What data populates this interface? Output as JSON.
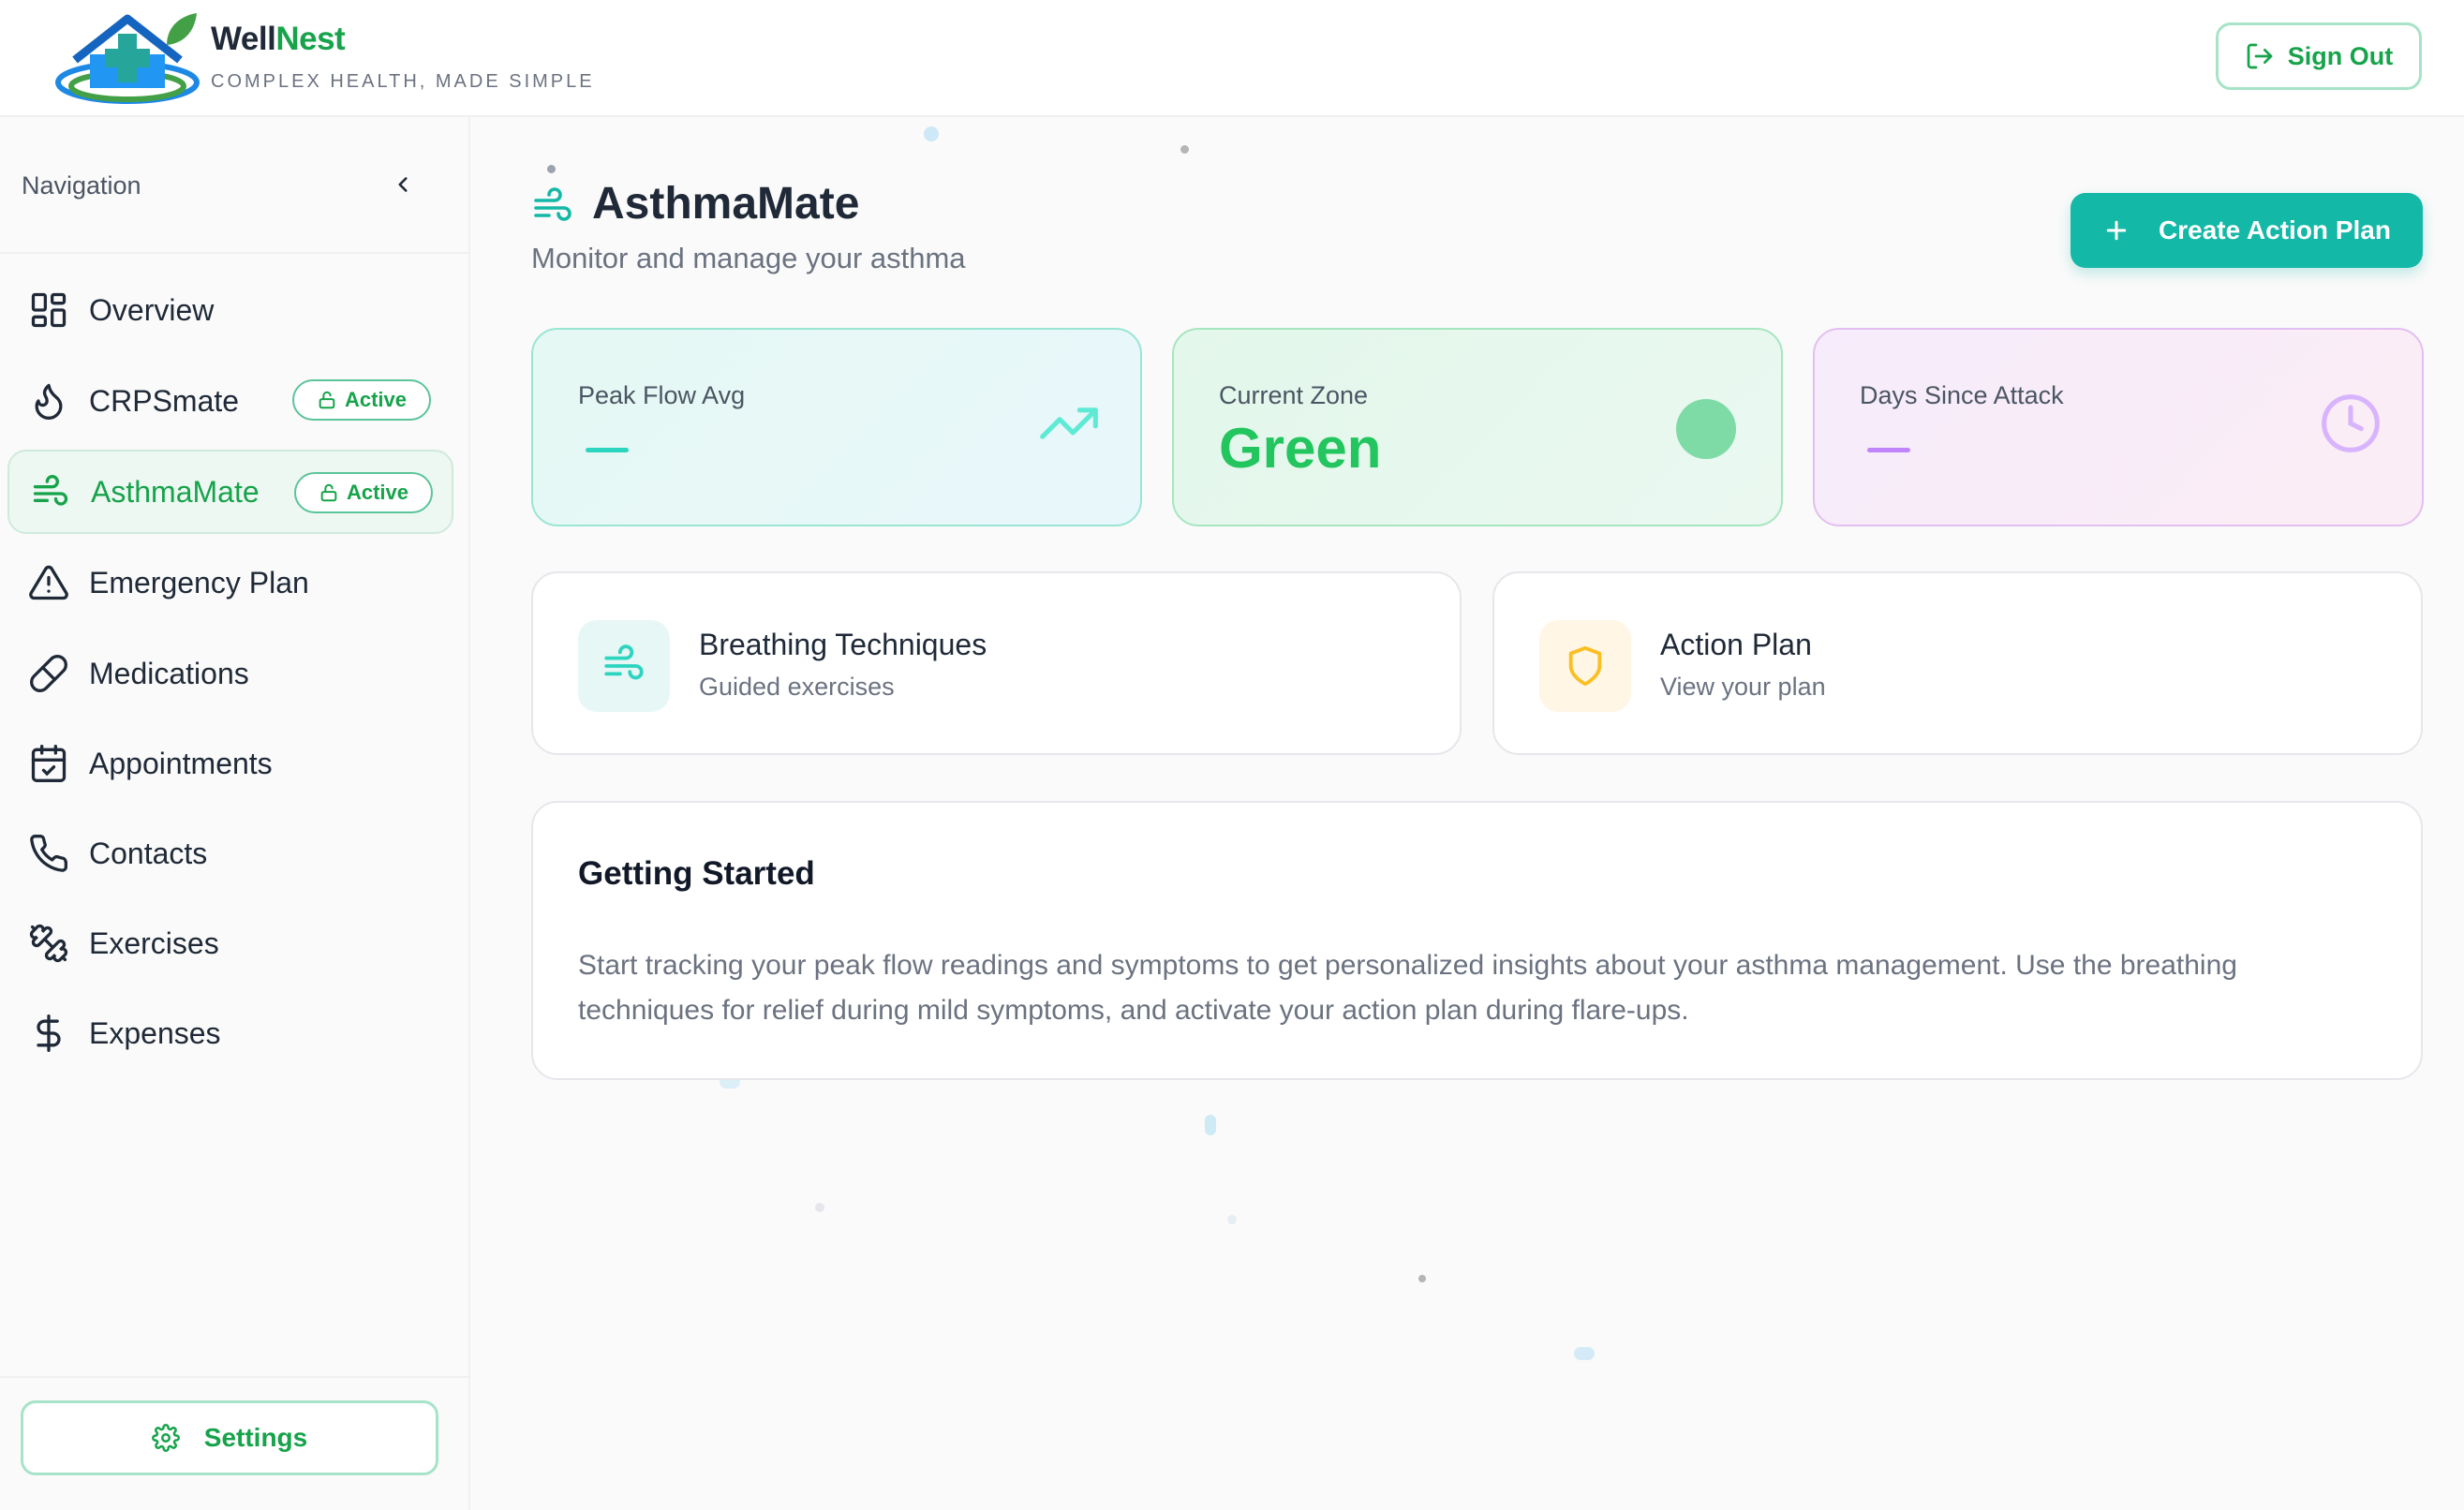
{
  "app": {
    "brand_part1": "Well",
    "brand_part2": "Nest",
    "tagline": "COMPLEX HEALTH, MADE SIMPLE",
    "sign_out_label": "Sign Out"
  },
  "colors": {
    "brand_green": "#16a34a",
    "accent_teal": "#14b8a6",
    "zone_green": "#22c55e",
    "purple": "#c084fc"
  },
  "sidebar": {
    "title": "Navigation",
    "items": [
      {
        "label": "Overview",
        "icon": "grid-icon"
      },
      {
        "label": "CRPSmate",
        "icon": "flame-icon",
        "badge": "Active"
      },
      {
        "label": "AsthmaMate",
        "icon": "wind-icon",
        "badge": "Active",
        "active": true
      },
      {
        "label": "Emergency Plan",
        "icon": "warning-triangle-icon"
      },
      {
        "label": "Medications",
        "icon": "pill-icon"
      },
      {
        "label": "Appointments",
        "icon": "calendar-icon"
      },
      {
        "label": "Contacts",
        "icon": "phone-icon"
      },
      {
        "label": "Exercises",
        "icon": "dumbbell-icon"
      },
      {
        "label": "Expenses",
        "icon": "dollar-icon"
      }
    ],
    "settings_label": "Settings"
  },
  "main": {
    "title": "AsthmaMate",
    "subtitle": "Monitor and manage your asthma",
    "create_button": "Create Action Plan",
    "stats": [
      {
        "label": "Peak Flow Avg",
        "value": "—",
        "icon": "trending-up-icon"
      },
      {
        "label": "Current Zone",
        "value": "Green",
        "icon": "zone-dot"
      },
      {
        "label": "Days Since Attack",
        "value": "—",
        "icon": "clock-icon"
      }
    ],
    "quick_links": [
      {
        "title": "Breathing Techniques",
        "subtitle": "Guided exercises",
        "icon": "wind-icon"
      },
      {
        "title": "Action Plan",
        "subtitle": "View your plan",
        "icon": "shield-icon"
      }
    ],
    "getting_started": {
      "title": "Getting Started",
      "body": "Start tracking your peak flow readings and symptoms to get personalized insights about your asthma management. Use the breathing techniques for relief during mild symptoms, and activate your action plan during flare-ups."
    }
  }
}
